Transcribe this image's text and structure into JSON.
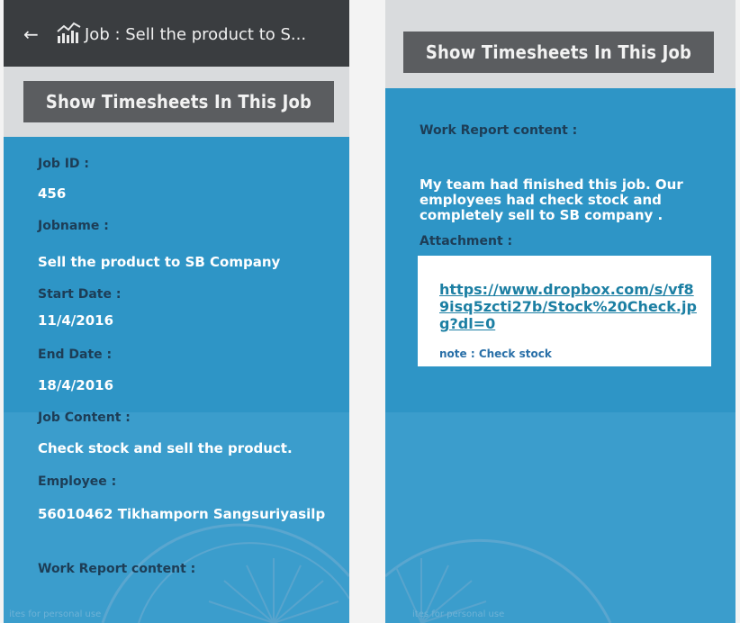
{
  "left": {
    "appbar": {
      "back_icon": "←",
      "app_icon": "chart-icon",
      "title": "Job : Sell the product to S..."
    },
    "show_button": "Show Timesheets In This Job",
    "fields": {
      "job_id_label": "Job ID :",
      "job_id_value": "456",
      "jobname_label": "Jobname :",
      "jobname_value": "Sell the product to SB Company",
      "start_label": "Start Date :",
      "start_value": "11/4/2016",
      "end_label": "End Date :",
      "end_value": "18/4/2016",
      "content_label": "Job Content :",
      "content_value": "Check stock and sell the product.",
      "employee_label": "Employee :",
      "employee_value": "56010462 Tikhamporn Sangsuriyasilp",
      "report_label": "Work Report content :"
    },
    "footer_faint": "ites for personal use"
  },
  "right": {
    "show_button": "Show Timesheets In This Job",
    "report_label": "Work Report content :",
    "report_text": "My team had finished this job. Our employees had check stock and completely sell to SB company .",
    "attachment_label": "Attachment :",
    "attachment_link": "https://www.dropbox.com/s/vf89isq5zcti27b/Stock%20Check.jpg?dl=0",
    "note": "note : Check stock",
    "footer_faint": "ites for personal use"
  },
  "colors": {
    "panel_blue": "#2e95c6",
    "label_dark": "#1d3d56",
    "button_grey": "#5b5d60",
    "appbar_dark": "#3a3d40",
    "link_blue": "#1c7fa3"
  }
}
